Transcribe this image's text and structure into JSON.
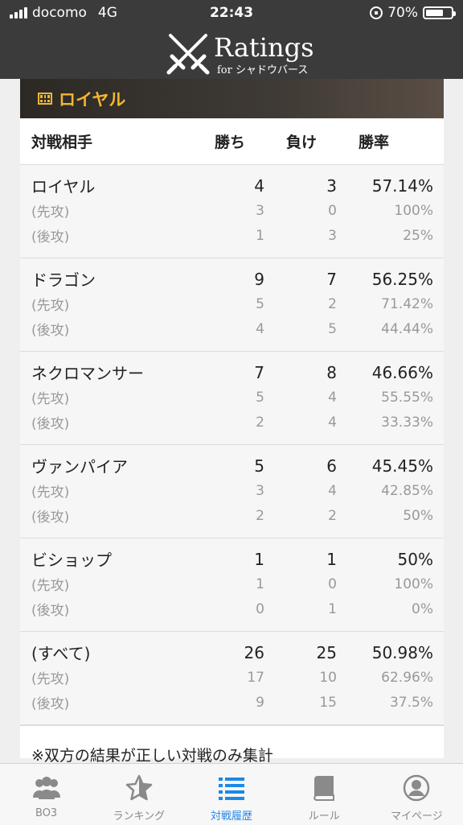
{
  "status": {
    "carrier": "docomo",
    "network": "4G",
    "time": "22:43",
    "battery": "70%",
    "battery_level": 0.7
  },
  "header": {
    "logo_title": "Ratings",
    "logo_sub": "for シャドウバース"
  },
  "section": {
    "title": "ロイヤル"
  },
  "columns": {
    "opponent": "対戦相手",
    "wins": "勝ち",
    "losses": "負け",
    "rate": "勝率"
  },
  "groups": [
    {
      "name": "ロイヤル",
      "wins": "4",
      "losses": "3",
      "rate": "57.14%",
      "first": {
        "label": "(先攻)",
        "wins": "3",
        "losses": "0",
        "rate": "100%"
      },
      "second": {
        "label": "(後攻)",
        "wins": "1",
        "losses": "3",
        "rate": "25%"
      }
    },
    {
      "name": "ドラゴン",
      "wins": "9",
      "losses": "7",
      "rate": "56.25%",
      "first": {
        "label": "(先攻)",
        "wins": "5",
        "losses": "2",
        "rate": "71.42%"
      },
      "second": {
        "label": "(後攻)",
        "wins": "4",
        "losses": "5",
        "rate": "44.44%"
      }
    },
    {
      "name": "ネクロマンサー",
      "wins": "7",
      "losses": "8",
      "rate": "46.66%",
      "first": {
        "label": "(先攻)",
        "wins": "5",
        "losses": "4",
        "rate": "55.55%"
      },
      "second": {
        "label": "(後攻)",
        "wins": "2",
        "losses": "4",
        "rate": "33.33%"
      }
    },
    {
      "name": "ヴァンパイア",
      "wins": "5",
      "losses": "6",
      "rate": "45.45%",
      "first": {
        "label": "(先攻)",
        "wins": "3",
        "losses": "4",
        "rate": "42.85%"
      },
      "second": {
        "label": "(後攻)",
        "wins": "2",
        "losses": "2",
        "rate": "50%"
      }
    },
    {
      "name": "ビショップ",
      "wins": "1",
      "losses": "1",
      "rate": "50%",
      "first": {
        "label": "(先攻)",
        "wins": "1",
        "losses": "0",
        "rate": "100%"
      },
      "second": {
        "label": "(後攻)",
        "wins": "0",
        "losses": "1",
        "rate": "0%"
      }
    },
    {
      "name": "(すべて)",
      "wins": "26",
      "losses": "25",
      "rate": "50.98%",
      "first": {
        "label": "(先攻)",
        "wins": "17",
        "losses": "10",
        "rate": "62.96%"
      },
      "second": {
        "label": "(後攻)",
        "wins": "9",
        "losses": "15",
        "rate": "37.5%"
      }
    }
  ],
  "note": "※双方の結果が正しい対戦のみ集計",
  "tabs": [
    {
      "label": "BO3",
      "icon": "group-icon"
    },
    {
      "label": "ランキング",
      "icon": "star-icon"
    },
    {
      "label": "対戦履歴",
      "icon": "list-icon",
      "active": true
    },
    {
      "label": "ルール",
      "icon": "book-icon"
    },
    {
      "label": "マイページ",
      "icon": "user-icon"
    }
  ],
  "colors": {
    "accent": "#1e88e5",
    "section_title": "#f2b630",
    "header_bg": "#3b3b3b"
  }
}
